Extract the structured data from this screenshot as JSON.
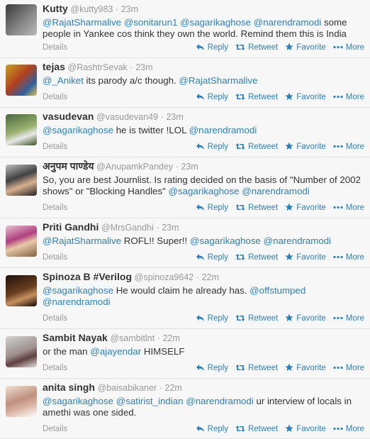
{
  "labels": {
    "details": "Details",
    "reply": "Reply",
    "retweet": "Retweet",
    "favorite": "Favorite",
    "more": "More",
    "sep": "·"
  },
  "tweets": [
    {
      "fullname": "Kutty",
      "username": "@kutty983",
      "time": "23m",
      "parts": [
        {
          "t": "@RajatSharmalive",
          "m": true
        },
        {
          "t": " "
        },
        {
          "t": "@sonitarun1",
          "m": true
        },
        {
          "t": " "
        },
        {
          "t": "@sagarikaghose",
          "m": true
        },
        {
          "t": " "
        },
        {
          "t": "@narendramodi",
          "m": true
        },
        {
          "t": " some people in Yankee cos think they own the world. Remind them this is India"
        }
      ]
    },
    {
      "fullname": "tejas",
      "username": "@RashtrSevak",
      "time": "23m",
      "parts": [
        {
          "t": "@_Aniket",
          "m": true
        },
        {
          "t": "  its parody a/c though. "
        },
        {
          "t": "@RajatSharmalive",
          "m": true
        }
      ]
    },
    {
      "fullname": "vasudevan",
      "username": "@vasudevan49",
      "time": "23m",
      "parts": [
        {
          "t": "@sagarikaghose",
          "m": true
        },
        {
          "t": " he is twitter !LOL "
        },
        {
          "t": "@narendramodi",
          "m": true
        }
      ]
    },
    {
      "fullname": "अनुपम पाण्डेय",
      "username": "@AnupamkPandey",
      "time": "23m",
      "parts": [
        {
          "t": "So, you are best Journlist. Is rating decided on the basis of \"Number of 2002 shows\" or \"Blocking Handles\" "
        },
        {
          "t": "@sagarikaghose",
          "m": true
        },
        {
          "t": " "
        },
        {
          "t": "@narendramodi",
          "m": true
        }
      ]
    },
    {
      "fullname": "Priti Gandhi",
      "username": "@MrsGandhi",
      "time": "23m",
      "parts": [
        {
          "t": "@RajatSharmalive",
          "m": true
        },
        {
          "t": " ROFL!! Super!! "
        },
        {
          "t": "@sagarikaghose",
          "m": true
        },
        {
          "t": " "
        },
        {
          "t": "@narendramodi",
          "m": true
        }
      ]
    },
    {
      "fullname": "Spinoza B #Verilog",
      "username": "@spinoza9642",
      "time": "22m",
      "parts": [
        {
          "t": "@sagarikaghose",
          "m": true
        },
        {
          "t": " He would claim he already has. "
        },
        {
          "t": "@offstumped",
          "m": true
        },
        {
          "t": " "
        },
        {
          "t": "@narendramodi",
          "m": true
        }
      ]
    },
    {
      "fullname": "Sambit Nayak",
      "username": "@sambitlnt",
      "time": "22m",
      "parts": [
        {
          "t": "or the man "
        },
        {
          "t": "@ajayendar",
          "m": true
        },
        {
          "t": " HIMSELF"
        }
      ]
    },
    {
      "fullname": "anita singh",
      "username": "@baisabikaner",
      "time": "22m",
      "parts": [
        {
          "t": "@sagarikaghose",
          "m": true
        },
        {
          "t": " "
        },
        {
          "t": "@satirist_indian",
          "m": true
        },
        {
          "t": " "
        },
        {
          "t": "@narendramodi",
          "m": true
        },
        {
          "t": " ur interview of locals in amethi was one sided."
        }
      ]
    }
  ]
}
